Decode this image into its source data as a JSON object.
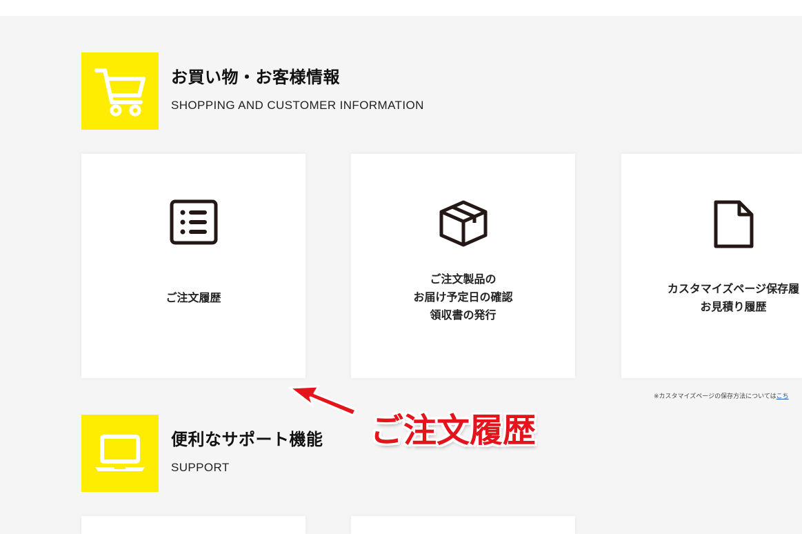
{
  "sections": {
    "shopping": {
      "title": "お買い物・お客様情報",
      "subtitle": "SHOPPING AND CUSTOMER INFORMATION",
      "icon": "shopping-cart-icon"
    },
    "support": {
      "title": "便利なサポート機能",
      "subtitle": "SUPPORT",
      "icon": "laptop-icon"
    }
  },
  "cards": [
    {
      "label": "ご注文履歴",
      "icon": "list-icon"
    },
    {
      "label": "ご注文製品の\nお届け予定日の確認\n領収書の発行",
      "icon": "box-icon"
    },
    {
      "label": "カスタマイズページ保存履\nお見積り履歴",
      "icon": "document-icon"
    }
  ],
  "note": {
    "text": "※カスタマイズページの保存方法については",
    "link": "こち"
  },
  "annotation": {
    "text": "ご注文履歴"
  },
  "colors": {
    "accent_yellow": "#ffed00",
    "background": "#f5f5f5",
    "annotation_red": "#e3141b"
  }
}
